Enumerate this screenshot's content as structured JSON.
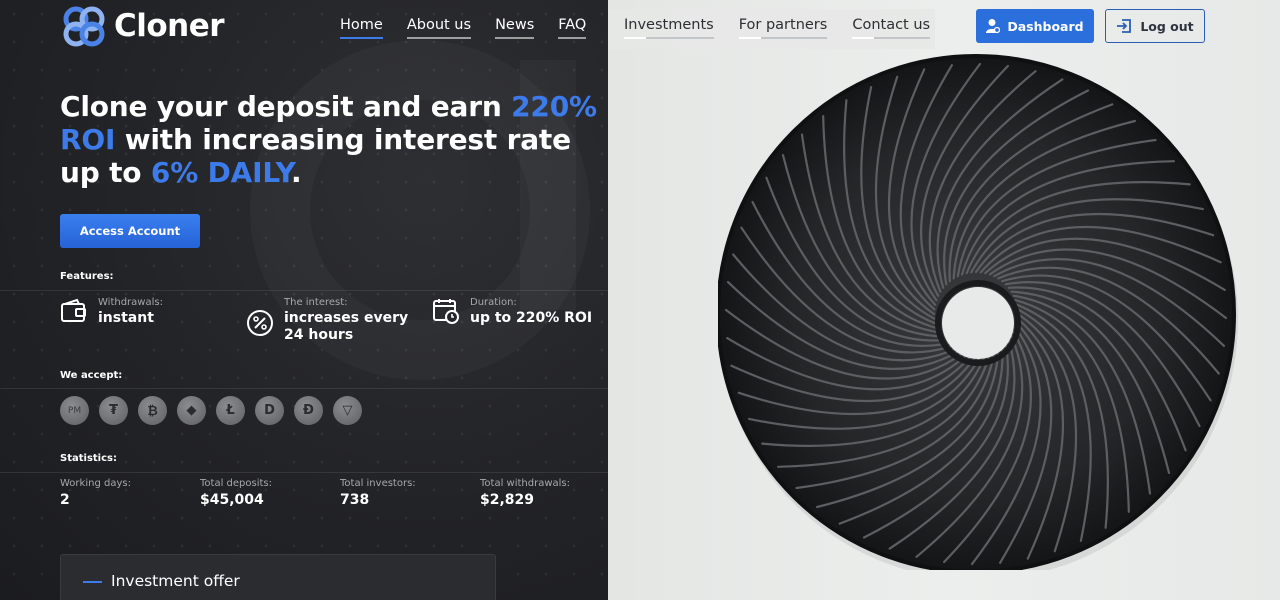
{
  "logo": {
    "text": "Cloner",
    "icon": "chain-link-logo-icon"
  },
  "nav": {
    "left": [
      {
        "label": "Home",
        "active": true
      },
      {
        "label": "About us"
      },
      {
        "label": "News"
      },
      {
        "label": "FAQ"
      }
    ],
    "right": [
      {
        "label": "Investments"
      },
      {
        "label": "For partners"
      },
      {
        "label": "Contact us"
      }
    ],
    "dashboard_label": "Dashboard",
    "logout_label": "Log out"
  },
  "hero": {
    "part1": "Clone your deposit and earn ",
    "hl1": "220% ROI",
    "part2": " with increasing interest rate up to ",
    "hl2": "6% DAILY",
    "part3": "."
  },
  "access_button": "Access Account",
  "features": {
    "title": "Features:",
    "items": [
      {
        "label": "Withdrawals:",
        "value": "instant",
        "icon": "wallet-icon"
      },
      {
        "label": "The interest:",
        "value": "increases every 24 hours",
        "icon": "percent-badge-icon"
      },
      {
        "label": "Duration:",
        "value": "up to 220% ROI",
        "icon": "calendar-clock-icon"
      }
    ]
  },
  "accept": {
    "title": "We accept:",
    "coins": [
      {
        "name": "perfect-money-icon",
        "glyph": "PM"
      },
      {
        "name": "tether-icon",
        "glyph": "₮"
      },
      {
        "name": "bitcoin-icon",
        "glyph": "₿"
      },
      {
        "name": "ethereum-icon",
        "glyph": "◆"
      },
      {
        "name": "litecoin-icon",
        "glyph": "Ł"
      },
      {
        "name": "dash-icon",
        "glyph": "D"
      },
      {
        "name": "dogecoin-icon",
        "glyph": "Đ"
      },
      {
        "name": "tron-icon",
        "glyph": "▽"
      }
    ]
  },
  "statistics": {
    "title": "Statistics:",
    "items": [
      {
        "label": "Working days:",
        "value": "2"
      },
      {
        "label": "Total deposits:",
        "value": "$45,004"
      },
      {
        "label": "Total investors:",
        "value": "738"
      },
      {
        "label": "Total withdrawals:",
        "value": "$2,829"
      }
    ]
  },
  "invest_offer": {
    "title": "Investment offer"
  },
  "colors": {
    "accent": "#3d7bea",
    "dark": "#222326",
    "light": "#e6e8e6"
  }
}
